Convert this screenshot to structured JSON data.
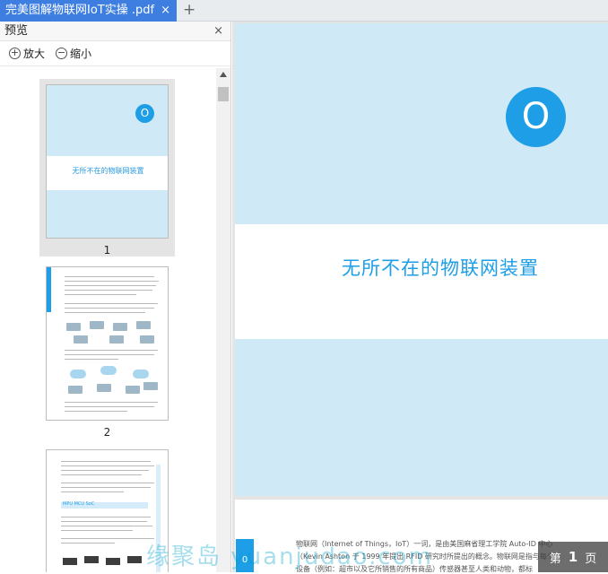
{
  "tab": {
    "title": "完美图解物联网IoT实操 .pdf",
    "close": "×",
    "add": "+"
  },
  "sidebar": {
    "title": "预览",
    "close": "×",
    "zoom_in": "放大",
    "zoom_out": "缩小",
    "pages": [
      {
        "number": "1",
        "title": "无所不在的物联网装置",
        "badge": "O"
      },
      {
        "number": "2"
      },
      {
        "bar_label": "MPU MCU SoC"
      }
    ]
  },
  "main": {
    "title": "无所不在的物联网装置",
    "badge": "O",
    "next_page_lines": [
      "物联网（Internet of Things，IoT）一词，是由美国麻省理工学院 Auto-ID 中心",
      "（Kevin Ashton 于 1999 年提出 RFID 研究时所提出的概念。物联网是指与每个",
      "设备（例如：超市以及它所销售的所有商品）传感器甚至人类和动物，都标"
    ],
    "next_page_badge": "0"
  },
  "page_indicator": {
    "prefix": "第",
    "number": "1",
    "suffix": "页"
  },
  "watermark": "缘聚岛 yuanjudao.com"
}
